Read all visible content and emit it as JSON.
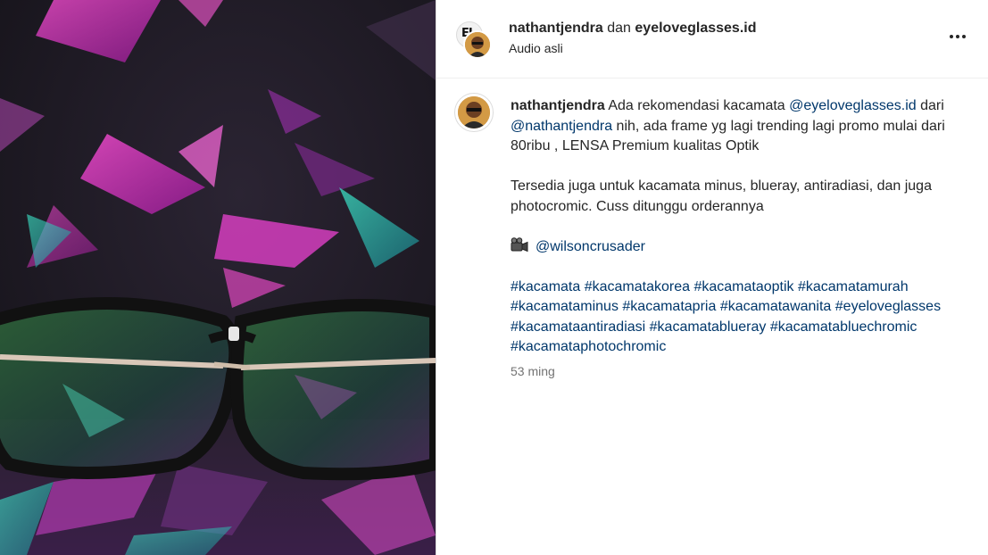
{
  "header": {
    "author": "nathantjendra",
    "conjunction": "dan",
    "collaborator": "eyeloveglasses.id",
    "audio": "Audio asli",
    "more_icon": "more-horizontal-icon",
    "logo_letters": "EL"
  },
  "caption": {
    "username": "nathantjendra",
    "p1_a": "Ada rekomendasi kacamata ",
    "p1_mention1": "@eyeloveglasses.id",
    "p1_b": " dari ",
    "p1_mention2": "@nathantjendra",
    "p1_c": " nih, ada frame yg lagi trending lagi promo mulai dari 80ribu , LENSA Premium kualitas Optik",
    "p2": "Tersedia juga untuk kacamata minus, blueray, antiradiasi, dan juga photocromic. Cuss ditunggu orderannya",
    "credit_icon": "video-camera-emoji",
    "credit_mention": "@wilsoncrusader",
    "hashtags": [
      "#kacamata",
      "#kacamatakorea",
      "#kacamataoptik",
      "#kacamatamurah",
      "#kacamataminus",
      "#kacamatapria",
      "#kacamatawanita",
      "#eyeloveglasses",
      "#kacamataantiradiasi",
      "#kacamatablueray",
      "#kacamatabluechromic",
      "#kacamataphotochromic"
    ],
    "time": "53 ming"
  },
  "colors": {
    "link": "#00376b",
    "muted": "#737373",
    "text": "#262626",
    "divider": "#dbdbdb"
  }
}
